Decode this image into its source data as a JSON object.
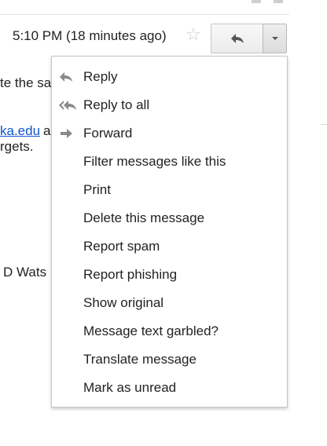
{
  "header": {
    "timestamp": "5:10 PM (18 minutes ago)",
    "star_icon": "star-outline-icon",
    "reply_icon": "reply-arrow-icon",
    "more_icon": "chevron-down-icon"
  },
  "background": {
    "line1": "te the sa",
    "link": "ka.edu",
    "link_suffix": "a",
    "line3": "rgets.",
    "signature": "D Wats"
  },
  "menu": {
    "items": [
      {
        "label": "Reply",
        "icon": "reply-icon"
      },
      {
        "label": "Reply to all",
        "icon": "reply-all-icon"
      },
      {
        "label": "Forward",
        "icon": "forward-icon"
      },
      {
        "label": "Filter messages like this"
      },
      {
        "label": "Print"
      },
      {
        "label": "Delete this message"
      },
      {
        "label": "Report spam"
      },
      {
        "label": "Report phishing"
      },
      {
        "label": "Show original"
      },
      {
        "label": "Message text garbled?"
      },
      {
        "label": "Translate message"
      },
      {
        "label": "Mark as unread"
      }
    ]
  },
  "colors": {
    "link": "#1155cc",
    "icon_gray": "#8a8a8a",
    "menu_border": "#c6c6c6"
  }
}
